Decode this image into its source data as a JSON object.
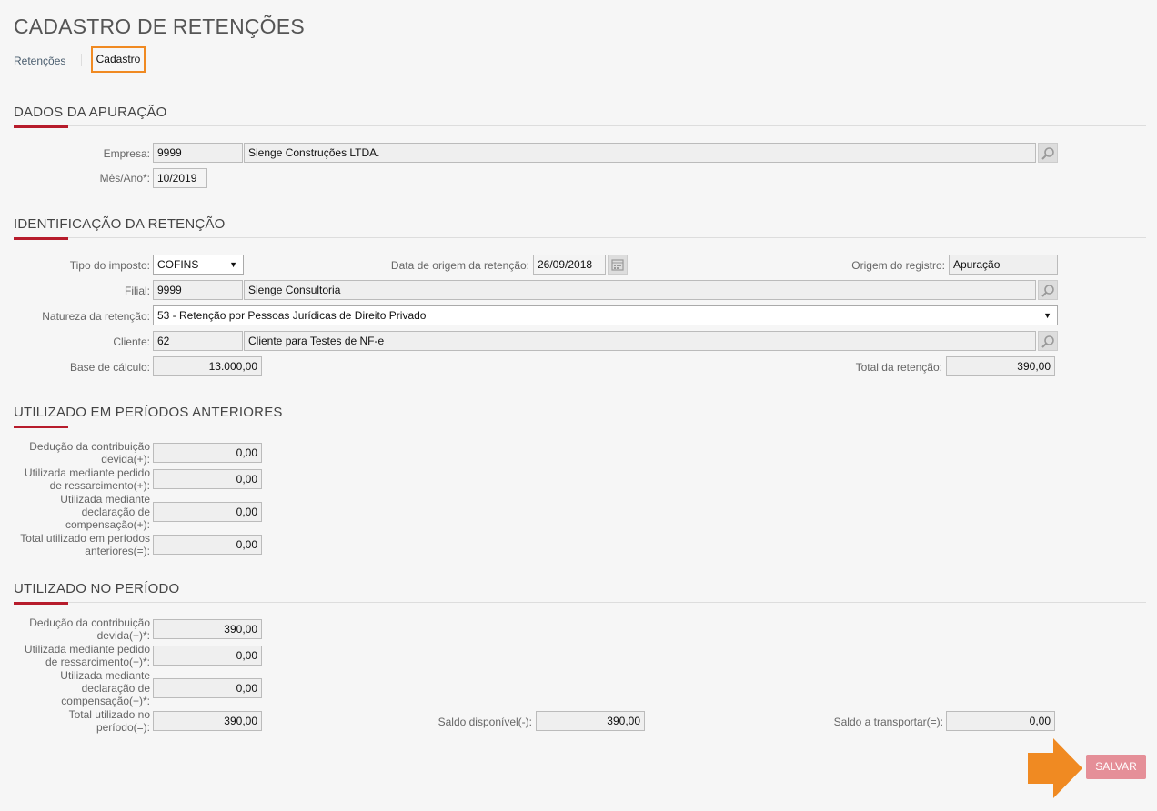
{
  "page": {
    "title": "CADASTRO DE RETENÇÕES"
  },
  "tabs": {
    "retencoes": "Retenções",
    "cadastro": "Cadastro"
  },
  "sections": {
    "dados": "DADOS DA APURAÇÃO",
    "identificacao": "IDENTIFICAÇÃO DA RETENÇÃO",
    "anteriores": "UTILIZADO EM PERÍODOS ANTERIORES",
    "periodo": "UTILIZADO NO PERÍODO"
  },
  "dados": {
    "empresa_label": "Empresa:",
    "empresa_code": "9999",
    "empresa_name": "Sienge Construções LTDA.",
    "mesano_label": "Mês/Ano*:",
    "mesano_value": "10/2019"
  },
  "identificacao": {
    "tipo_label": "Tipo do imposto:",
    "tipo_value": "COFINS",
    "data_label": "Data de origem da retenção:",
    "data_value": "26/09/2018",
    "origem_label": "Origem do registro:",
    "origem_value": "Apuração",
    "filial_label": "Filial:",
    "filial_code": "9999",
    "filial_name": "Sienge Consultoria",
    "natureza_label": "Natureza da retenção:",
    "natureza_value": "53 - Retenção por Pessoas Jurídicas de Direito Privado",
    "cliente_label": "Cliente:",
    "cliente_code": "62",
    "cliente_name": "Cliente para Testes de NF-e",
    "base_label": "Base de cálculo:",
    "base_value": "13.000,00",
    "total_label": "Total da retenção:",
    "total_value": "390,00"
  },
  "anteriores": {
    "deducao_l1": "Dedução da contribuição",
    "deducao_l2": "devida(+):",
    "deducao_value": "0,00",
    "ressarc_l1": "Utilizada mediante pedido",
    "ressarc_l2": "de ressarcimento(+):",
    "ressarc_value": "0,00",
    "compens_l1": "Utilizada mediante",
    "compens_l2": "declaração de",
    "compens_l3": "compensação(+):",
    "compens_value": "0,00",
    "total_l1": "Total utilizado em períodos",
    "total_l2": "anteriores(=):",
    "total_value": "0,00"
  },
  "periodo": {
    "deducao_l1": "Dedução da contribuição",
    "deducao_l2": "devida(+)*:",
    "deducao_value": "390,00",
    "ressarc_l1": "Utilizada mediante pedido",
    "ressarc_l2": "de ressarcimento(+)*:",
    "ressarc_value": "0,00",
    "compens_l1": "Utilizada mediante",
    "compens_l2": "declaração de",
    "compens_l3": "compensação(+)*:",
    "compens_value": "0,00",
    "total_l1": "Total utilizado no",
    "total_l2": "período(=):",
    "total_value": "390,00",
    "saldo_label": "Saldo disponível(-):",
    "saldo_value": "390,00",
    "transp_label": "Saldo a transportar(=):",
    "transp_value": "0,00"
  },
  "actions": {
    "save_label": "SALVAR"
  },
  "colors": {
    "accent": "#b71c2c",
    "highlight": "#f08a22",
    "save": "#e58f98"
  }
}
